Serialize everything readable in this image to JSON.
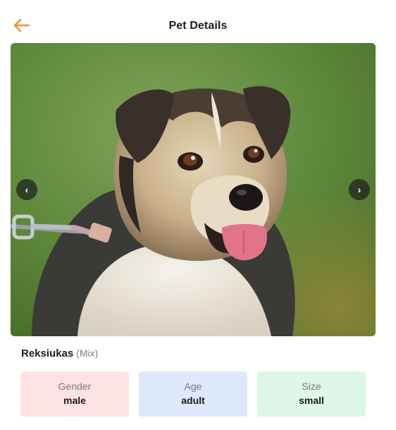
{
  "header": {
    "title": "Pet Details",
    "back_icon": "arrow-left-icon"
  },
  "colors": {
    "accent": "#e9963a",
    "gender_bg": "#fde2e4",
    "age_bg": "#dde8fb",
    "size_bg": "#ddf6e7"
  },
  "gallery": {
    "prev_icon": "chevron-left-icon",
    "next_icon": "chevron-right-icon",
    "prev_glyph": "‹",
    "next_glyph": "›"
  },
  "pet": {
    "name": "Reksiukas",
    "breed": "(Mix)"
  },
  "attributes": [
    {
      "label": "Gender",
      "value": "male"
    },
    {
      "label": "Age",
      "value": "adult"
    },
    {
      "label": "Size",
      "value": "small"
    }
  ]
}
